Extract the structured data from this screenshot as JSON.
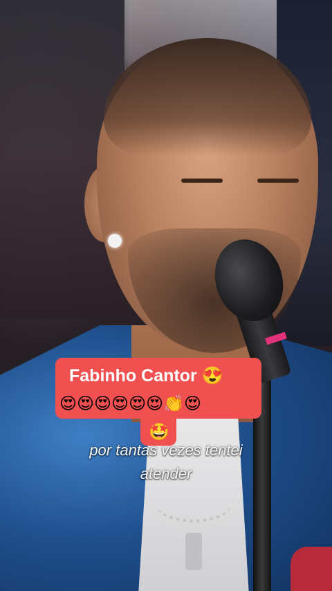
{
  "comment": {
    "author_line": "Fabinho Cantor 😍",
    "reaction_line": "😍😍😍😍😍😍👏😍",
    "reaction_overflow": "🤩",
    "background_color": "#f0504f"
  },
  "caption": {
    "line1": "por tantas vezes tentei",
    "line2": "atender"
  }
}
